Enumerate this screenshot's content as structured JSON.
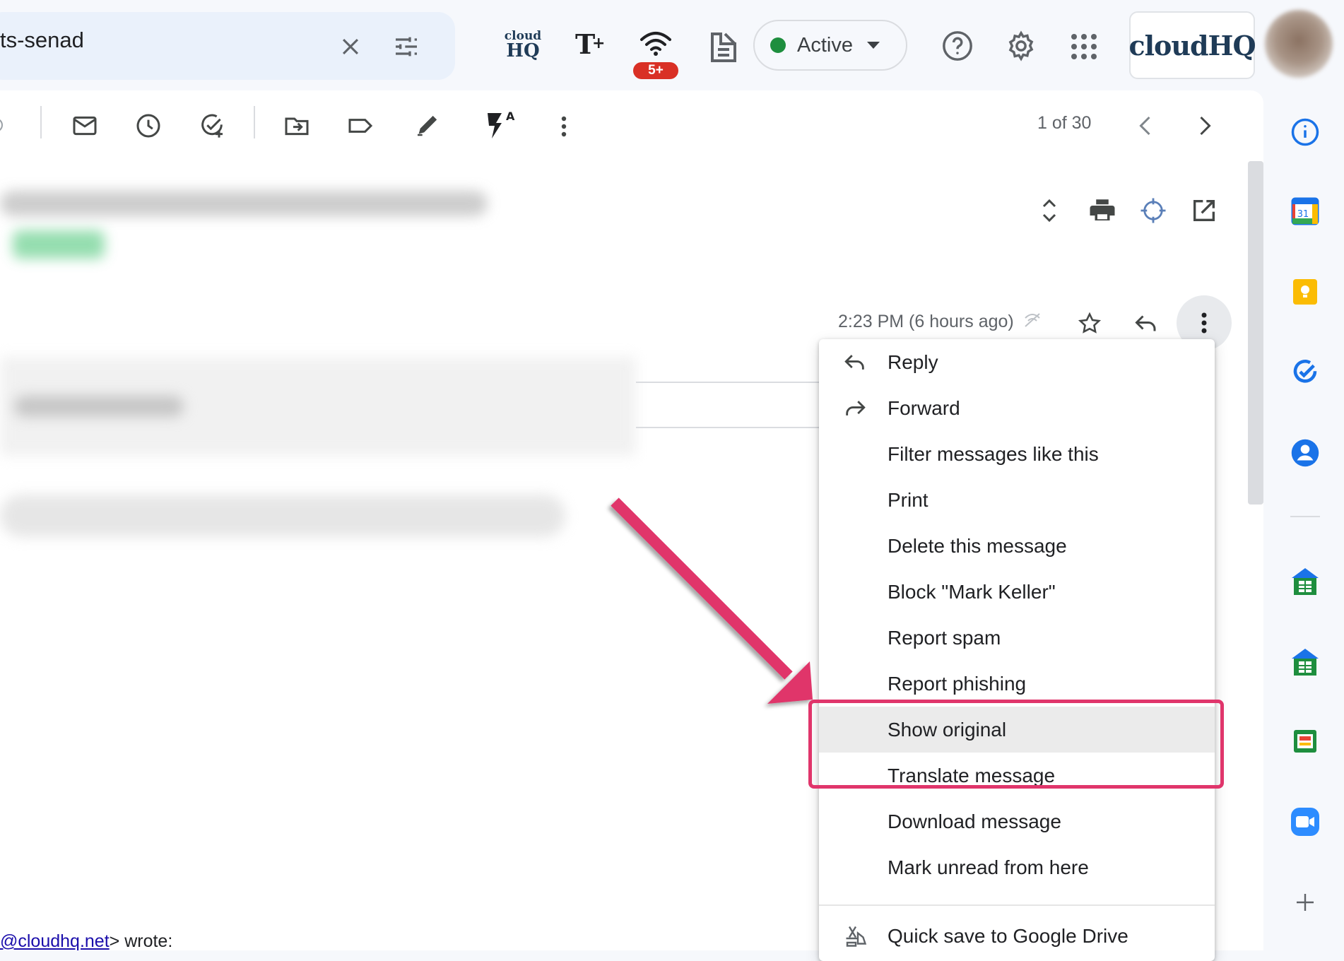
{
  "search": {
    "query": "ts-senad"
  },
  "topbar": {
    "cloudhq_badge_top": "cloud",
    "cloudhq_badge_bottom": "HQ",
    "signal_badge": "5+",
    "status_label": "Active",
    "brand": "cloudHQ"
  },
  "toolbar": {
    "counter": "1 of 30"
  },
  "message": {
    "time": "2:23 PM (6 hours ago)",
    "quote_link": "@cloudhq.net",
    "quote_suffix": "> wrote:"
  },
  "menu": {
    "items": [
      {
        "label": "Reply",
        "icon": "reply-icon"
      },
      {
        "label": "Forward",
        "icon": "forward-icon"
      },
      {
        "label": "Filter messages like this"
      },
      {
        "label": "Print"
      },
      {
        "label": "Delete this message"
      },
      {
        "label": "Block \"Mark Keller\""
      },
      {
        "label": "Report spam"
      },
      {
        "label": "Report phishing"
      },
      {
        "label": "Show original"
      },
      {
        "label": "Translate message"
      },
      {
        "label": "Download message"
      },
      {
        "label": "Mark unread from here"
      },
      {
        "label": "Quick save to Google Drive",
        "icon": "drive-save-icon"
      }
    ],
    "highlighted": "Show original"
  },
  "sidepanel": {
    "calendar_day": "31"
  },
  "colors": {
    "accent": "#e0356b",
    "active_dot": "#1e8e3e",
    "badge": "#d93025",
    "side_blue": "#1a73e8"
  }
}
